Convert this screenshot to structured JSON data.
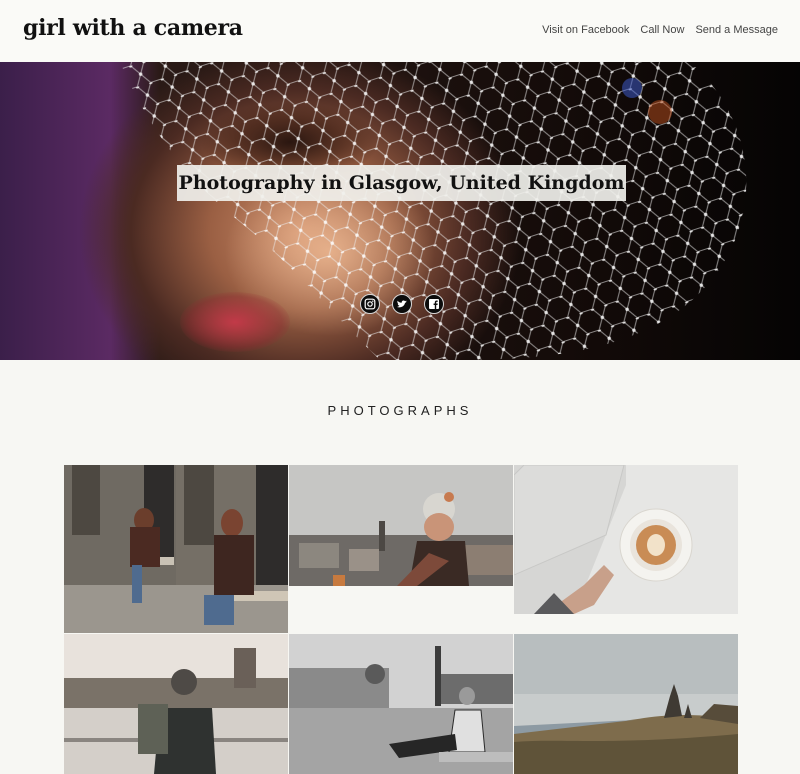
{
  "header": {
    "brand": "girl with a camera",
    "nav": [
      {
        "label": "Visit on Facebook"
      },
      {
        "label": "Call Now"
      },
      {
        "label": "Send a Message"
      }
    ]
  },
  "hero": {
    "title": "Photography in Glasgow, United Kingdom",
    "social_icons": [
      "instagram-icon",
      "twitter-icon",
      "facebook-icon"
    ]
  },
  "section": {
    "title": "PHOTOGRAPHS"
  },
  "colors": {
    "page_background": "#f7f7f3",
    "text_dark": "#111111",
    "nav_text": "#444444"
  }
}
